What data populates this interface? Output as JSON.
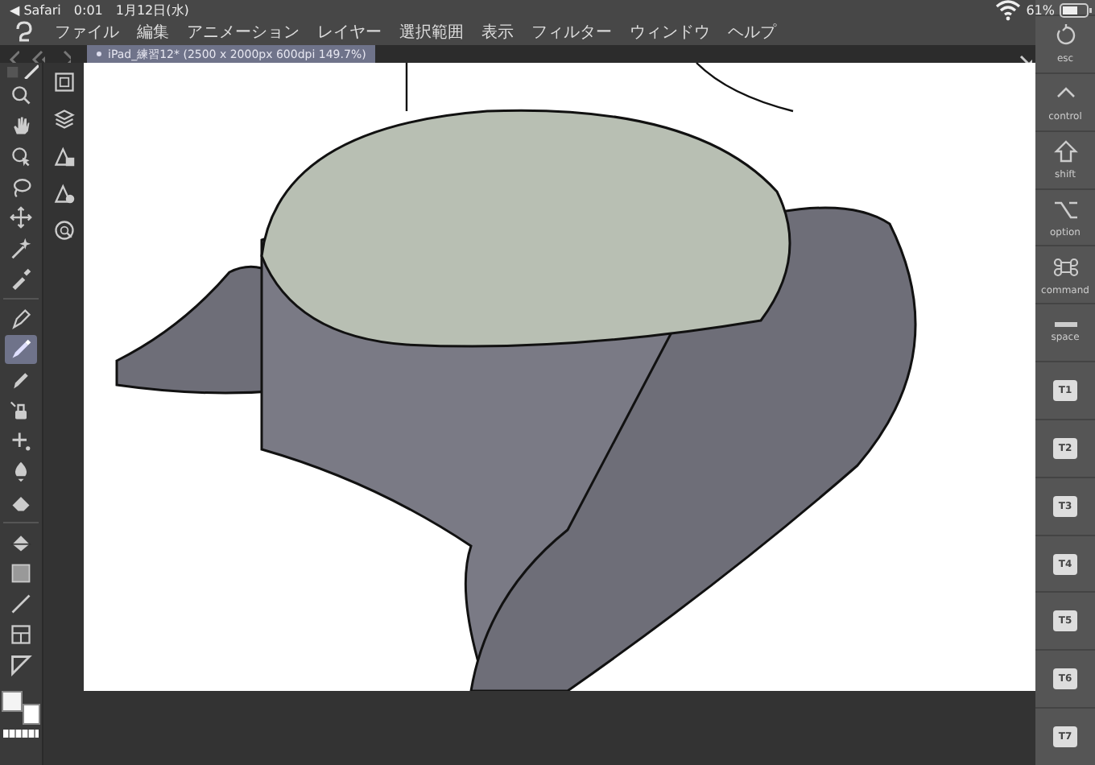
{
  "status_bar": {
    "back_app": "◀ Safari",
    "time": "0:01",
    "date": "1月12日(水)",
    "battery": "61%"
  },
  "menu": [
    "ファイル",
    "編集",
    "アニメーション",
    "レイヤー",
    "選択範囲",
    "表示",
    "フィルター",
    "ウィンドウ",
    "ヘルプ"
  ],
  "document_tab": {
    "title": "iPad_練習12* (2500 x 2000px 600dpi 149.7%)",
    "selected": true
  },
  "tools": [
    {
      "selected": false
    },
    {
      "selected": false
    },
    {
      "selected": false
    },
    {
      "selected": false
    },
    {
      "selected": false
    },
    {
      "selected": false
    },
    {
      "selected": false
    },
    {
      "selected": false
    },
    {
      "selected": true
    },
    {
      "selected": false
    },
    {
      "selected": false
    },
    {
      "selected": false
    },
    {
      "selected": false
    },
    {
      "selected": false
    },
    {
      "selected": false
    },
    {
      "selected": false
    },
    {
      "selected": false
    },
    {
      "selected": false
    },
    {
      "selected": false
    }
  ],
  "modifier_keys": [
    {
      "kind": "icon",
      "label": "esc"
    },
    {
      "kind": "icon",
      "label": "control"
    },
    {
      "kind": "icon",
      "label": "shift"
    },
    {
      "kind": "icon",
      "label": "option"
    },
    {
      "kind": "icon",
      "label": "command"
    },
    {
      "kind": "icon",
      "label": "space"
    },
    {
      "kind": "tag",
      "label": "T1"
    },
    {
      "kind": "tag",
      "label": "T2"
    },
    {
      "kind": "tag",
      "label": "T3"
    },
    {
      "kind": "tag",
      "label": "T4"
    },
    {
      "kind": "tag",
      "label": "T5"
    },
    {
      "kind": "tag",
      "label": "T6"
    },
    {
      "kind": "tag",
      "label": "T7"
    }
  ]
}
